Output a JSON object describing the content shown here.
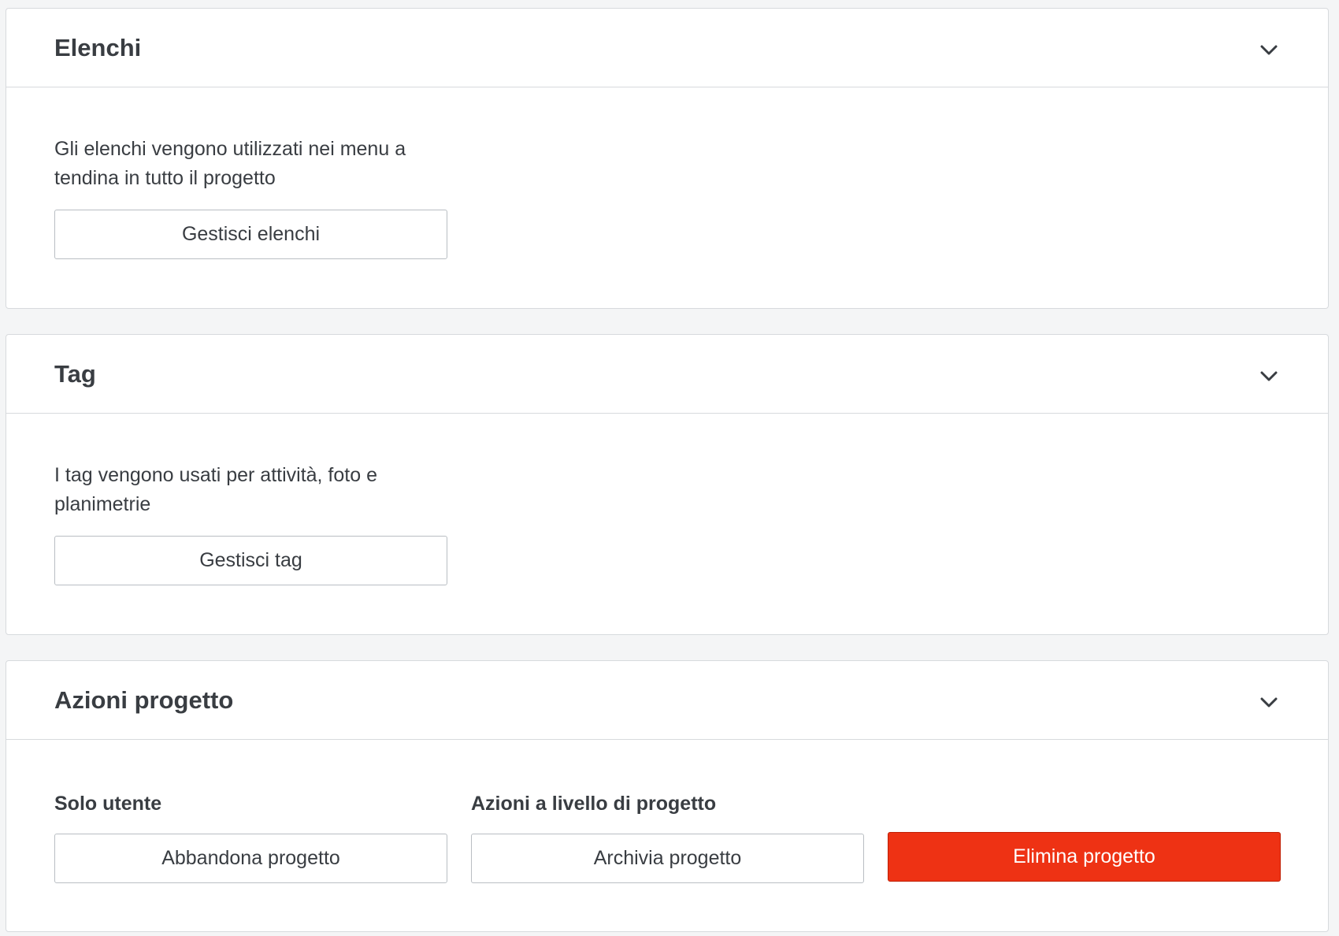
{
  "lists_card": {
    "title": "Elenchi",
    "description": "Gli elenchi vengono utilizzati nei menu a tendina in tutto il progetto",
    "button_label": "Gestisci elenchi",
    "chevron_icon": "chevron-down-icon"
  },
  "tags_card": {
    "title": "Tag",
    "description": "I tag vengono usati per attività, foto e planimetrie",
    "button_label": "Gestisci tag",
    "chevron_icon": "chevron-down-icon"
  },
  "project_actions_card": {
    "title": "Azioni progetto",
    "chevron_icon": "chevron-down-icon",
    "user_only": {
      "label": "Solo utente",
      "leave_button_label": "Abbandona progetto"
    },
    "project_level": {
      "label": "Azioni a livello di progetto",
      "archive_button_label": "Archivia progetto",
      "delete_button_label": "Elimina progetto"
    }
  },
  "colors": {
    "danger": "#ee3214",
    "text": "#393d42",
    "border": "#d7dadd",
    "background": "#f4f5f6"
  }
}
